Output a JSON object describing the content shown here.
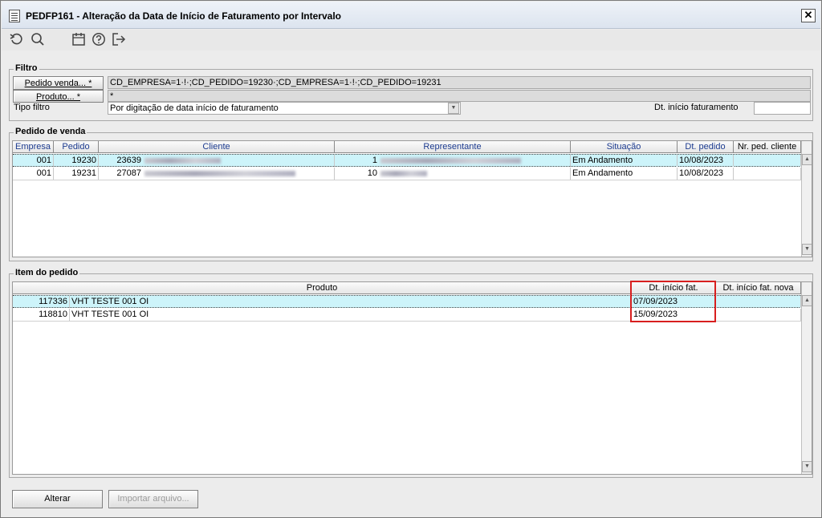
{
  "window": {
    "title": "PEDFP161 - Alteração da Data de Início de Faturamento por Intervalo",
    "close_glyph": "✕"
  },
  "toolbar": {
    "icons": [
      "undo-icon",
      "search-icon",
      "calendar-icon",
      "help-icon",
      "exit-icon"
    ]
  },
  "filtro": {
    "title": "Filtro",
    "pedido_btn": "Pedido venda... *",
    "pedido_value": "CD_EMPRESA=1·!·;CD_PEDIDO=19230·;CD_EMPRESA=1·!·;CD_PEDIDO=19231",
    "produto_btn": "Produto... *",
    "produto_value": "*",
    "tipo_label": "Tipo filtro",
    "tipo_value": "Por digitação de data início de faturamento",
    "dt_label": "Dt. início faturamento",
    "dt_value": ""
  },
  "pedido_venda": {
    "title": "Pedido de venda",
    "headers": [
      "Empresa",
      "Pedido",
      "Cliente",
      "Representante",
      "Situação",
      "Dt. pedido",
      "Nr. ped. cliente"
    ],
    "rows": [
      {
        "empresa": "001",
        "pedido": "19230",
        "cliente_cod": "23639",
        "rep_cod": "1",
        "situacao": "Em Andamento",
        "dt_pedido": "10/08/2023",
        "nr_ped": ""
      },
      {
        "empresa": "001",
        "pedido": "19231",
        "cliente_cod": "27087",
        "rep_cod": "10",
        "situacao": "Em Andamento",
        "dt_pedido": "10/08/2023",
        "nr_ped": ""
      }
    ]
  },
  "item_pedido": {
    "title": "Item do pedido",
    "headers": [
      "Produto",
      "Dt. início fat.",
      "Dt. início fat. nova"
    ],
    "rows": [
      {
        "codigo": "117336",
        "descricao": "VHT TESTE 001 OI",
        "dt_inicio": "07/09/2023",
        "dt_nova": ""
      },
      {
        "codigo": "118810",
        "descricao": "VHT TESTE 001 OI",
        "dt_inicio": "15/09/2023",
        "dt_nova": ""
      }
    ]
  },
  "footer": {
    "alterar": "Alterar",
    "importar": "Importar arquivo..."
  }
}
